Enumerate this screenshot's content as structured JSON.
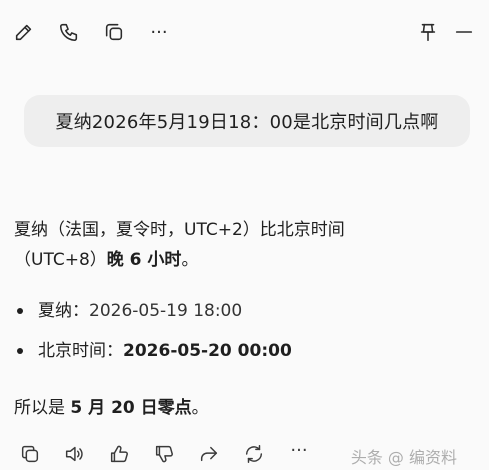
{
  "toolbar": {
    "icons": [
      "edit-icon",
      "phone-icon",
      "new-window-icon",
      "more-icon",
      "pin-icon",
      "minimize-icon"
    ],
    "more_label": "···"
  },
  "user_message": "夏纳2026年5月19日18：00是北京时间几点啊",
  "answer": {
    "line1": "夏纳（法国，夏令时，UTC+2）比北京时间",
    "line2_prefix": "（UTC+8）",
    "line2_bold": "晚 6 小时",
    "line2_suffix": "。"
  },
  "bullets": [
    {
      "label": "夏纳：",
      "value": "2026-05-19 18:00",
      "bold": false
    },
    {
      "label": "北京时间：",
      "value": "2026-05-20 00:00",
      "bold": true
    }
  ],
  "conclusion": {
    "prefix": "所以是 ",
    "bold": "5 月 20 日零点",
    "suffix": "。"
  },
  "actions": {
    "icons": [
      "copy-icon",
      "speaker-icon",
      "thumbs-up-icon",
      "thumbs-down-icon",
      "share-icon",
      "regenerate-icon",
      "more-icon"
    ]
  },
  "watermark": "头条 @ 编资料"
}
